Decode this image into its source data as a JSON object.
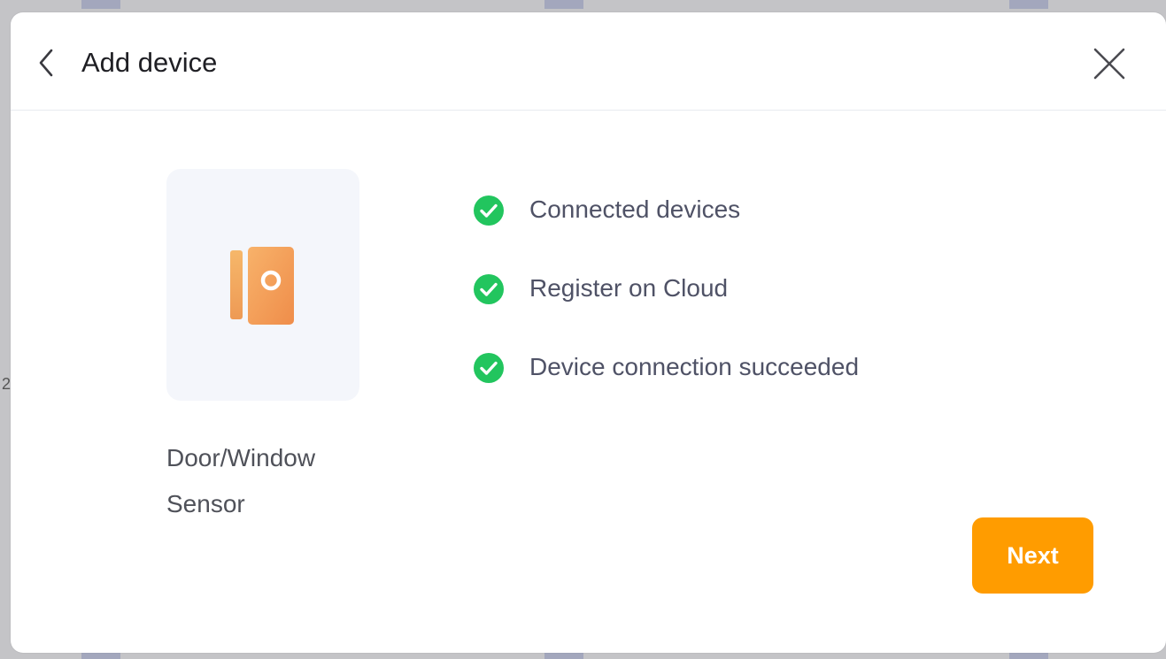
{
  "header": {
    "title": "Add device",
    "back_icon": "chevron-left-icon",
    "close_icon": "close-icon"
  },
  "device": {
    "name_line1": "Door/Window",
    "name_line2": "Sensor",
    "icon": "door-window-sensor-icon"
  },
  "steps": [
    {
      "label": "Connected devices",
      "status": "done"
    },
    {
      "label": "Register on Cloud",
      "status": "done"
    },
    {
      "label": "Device connection succeeded",
      "status": "done"
    }
  ],
  "actions": {
    "next_label": "Next"
  },
  "colors": {
    "accent": "#ff9c00",
    "success": "#22c55e",
    "card_bg": "#f4f6fb"
  },
  "background": {
    "edge_glyph": "2"
  }
}
